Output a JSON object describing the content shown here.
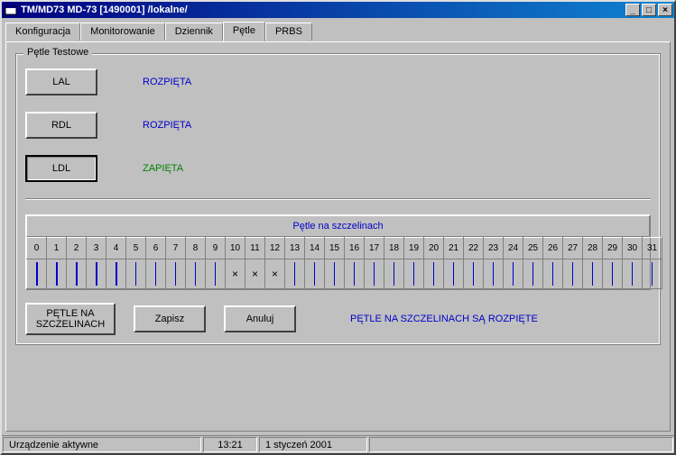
{
  "window": {
    "title": "TM/MD73 MD-73   [1490001]   /lokalne/"
  },
  "tabs": {
    "items": [
      {
        "label": "Konfiguracja"
      },
      {
        "label": "Monitorowanie"
      },
      {
        "label": "Dziennik"
      },
      {
        "label": "Pętle"
      },
      {
        "label": "PRBS"
      }
    ],
    "activeIndex": 3
  },
  "group": {
    "title": "Pętle Testowe"
  },
  "loops": [
    {
      "id": "lal",
      "button": "LAL",
      "status": "ROZPIĘTA",
      "on": false
    },
    {
      "id": "rdl",
      "button": "RDL",
      "status": "ROZPIĘTA",
      "on": false
    },
    {
      "id": "ldl",
      "button": "LDL",
      "status": "ZAPIĘTA",
      "on": true
    }
  ],
  "slots": {
    "title": "Pętle na szczelinach",
    "headers": [
      "0",
      "1",
      "2",
      "3",
      "4",
      "5",
      "6",
      "7",
      "8",
      "9",
      "10",
      "11",
      "12",
      "13",
      "14",
      "15",
      "16",
      "17",
      "18",
      "19",
      "20",
      "21",
      "22",
      "23",
      "24",
      "25",
      "26",
      "27",
      "28",
      "29",
      "30",
      "31"
    ],
    "cells": [
      "|",
      "|",
      "|",
      "|",
      "|",
      "",
      "",
      "",
      "",
      "",
      "×",
      "×",
      "×",
      "",
      "",
      "",
      "",
      "",
      "",
      "",
      "",
      "",
      "",
      "",
      "",
      "",
      "",
      "",
      "",
      "",
      "",
      ""
    ]
  },
  "buttons": {
    "petle": "PĘTLE NA\nSZCZELINACH",
    "zapisz": "Zapisz",
    "anuluj": "Anuluj"
  },
  "message": "PĘTLE NA SZCZELINACH SĄ ROZPIĘTE",
  "statusbar": {
    "device": "Urządzenie aktywne",
    "time": "13:21",
    "date": "1 styczeń 2001"
  }
}
